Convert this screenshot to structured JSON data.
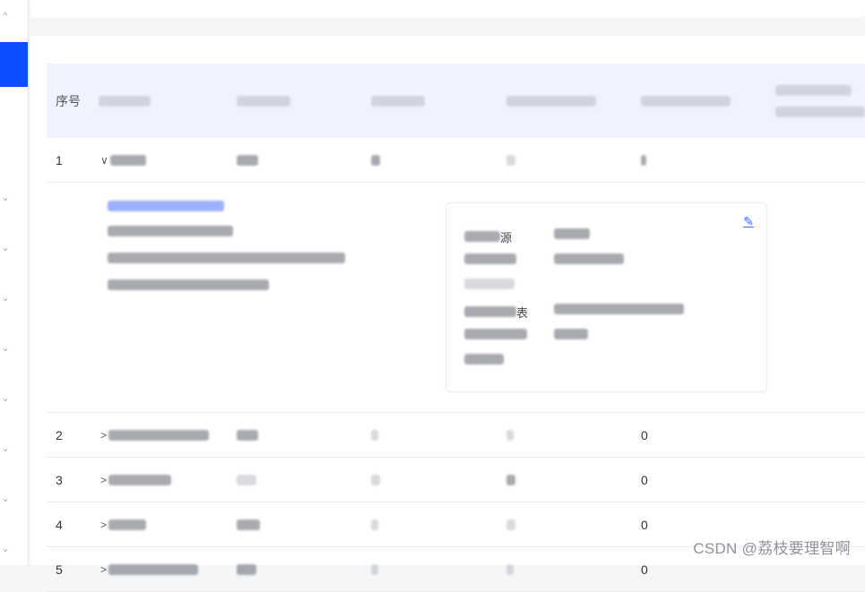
{
  "sidebar": {
    "chevron_up": "^",
    "chevron_down": "⌄"
  },
  "table": {
    "header_index": "序号",
    "rows": [
      {
        "index": "1",
        "last": ""
      },
      {
        "index": "2",
        "last": "0"
      },
      {
        "index": "3",
        "last": "0"
      },
      {
        "index": "4",
        "last": "0"
      },
      {
        "index": "5",
        "last": "0"
      }
    ],
    "detail": {
      "label_source_suffix": "源",
      "label_table_suffix": "表"
    }
  },
  "watermark": "CSDN @荔枝要理智啊",
  "colors": {
    "accent": "#0b4dff",
    "header_bg": "#eef3ff",
    "edit_icon": "#2f6bff"
  }
}
